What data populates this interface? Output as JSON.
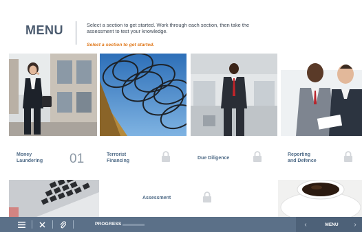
{
  "header": {
    "title": "MENU",
    "intro": "Select a section to get started. Work through each section, then take the assessment to test your knowledge.",
    "hint": "Select a section to get started."
  },
  "tiles": [
    {
      "label_line1": "Money",
      "label_line2": "Laundering",
      "number": "01",
      "locked": false
    },
    {
      "label_line1": "Terrorist",
      "label_line2": "Financing",
      "locked": true,
      "lock_icon": "lock-icon"
    },
    {
      "label_line1": "Due Diligence",
      "locked": true,
      "lock_icon": "lock-icon"
    },
    {
      "label_line1": "Reporting",
      "label_line2": "and Defence",
      "locked": true,
      "lock_icon": "lock-icon"
    }
  ],
  "assessment": {
    "label": "Assessment",
    "locked": true
  },
  "bottombar": {
    "icons": [
      "menu-icon",
      "close-icon",
      "paperclip-icon"
    ],
    "progress_label": "PROGRESS",
    "progress_fraction": 0.0,
    "prev_glyph": "‹",
    "menu_label": "MENU",
    "next_glyph": "›"
  },
  "colors": {
    "title": "#4a5a6e",
    "hint": "#e07a1e",
    "label": "#4e6a86",
    "bar": "#5b7088"
  }
}
